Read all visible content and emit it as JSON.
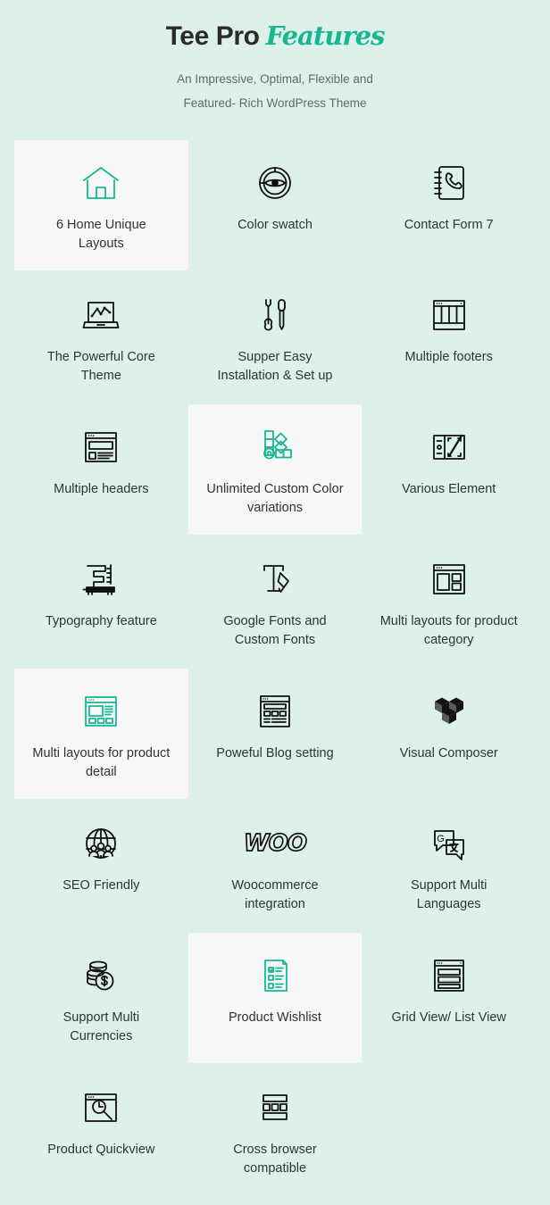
{
  "header": {
    "title_main": "Tee Pro",
    "title_script": "Features",
    "subtitle_line1": "An Impressive, Optimal, Flexible and",
    "subtitle_line2": "Featured- Rich WordPress Theme"
  },
  "theme": {
    "background": "#ddf0ea",
    "card_highlight": "#f7f7f7",
    "accent": "#16b894",
    "icon_dark": "#111111",
    "text": "#2e3533",
    "subtitle_text": "#5c6b68"
  },
  "features": [
    {
      "label": "6 Home Unique Layouts",
      "icon": "home-icon",
      "highlight": true,
      "accent": true
    },
    {
      "label": "Color swatch",
      "icon": "eye-swatch-icon",
      "highlight": false,
      "accent": false
    },
    {
      "label": "Contact Form 7",
      "icon": "phonebook-icon",
      "highlight": false,
      "accent": false
    },
    {
      "label": "The Powerful Core Theme",
      "icon": "laptop-chart-icon",
      "highlight": false,
      "accent": false
    },
    {
      "label": "Supper Easy Installation & Set up",
      "icon": "tools-icon",
      "highlight": false,
      "accent": false
    },
    {
      "label": "Multiple footers",
      "icon": "footers-layout-icon",
      "highlight": false,
      "accent": false
    },
    {
      "label": "Multiple headers",
      "icon": "headers-layout-icon",
      "highlight": false,
      "accent": false
    },
    {
      "label": "Unlimited Custom Color variations",
      "icon": "color-palette-icon",
      "highlight": true,
      "accent": true
    },
    {
      "label": "Various Element",
      "icon": "elements-icon",
      "highlight": false,
      "accent": false
    },
    {
      "label": "Typography feature",
      "icon": "typography-ruler-icon",
      "highlight": false,
      "accent": false
    },
    {
      "label": "Google Fonts and Custom Fonts",
      "icon": "font-pen-icon",
      "highlight": false,
      "accent": false
    },
    {
      "label": "Multi layouts for product category",
      "icon": "category-layout-icon",
      "highlight": false,
      "accent": false
    },
    {
      "label": "Multi layouts for product detail",
      "icon": "product-layout-icon",
      "highlight": true,
      "accent": true
    },
    {
      "label": "Poweful Blog setting",
      "icon": "blog-layout-icon",
      "highlight": false,
      "accent": false
    },
    {
      "label": "Visual Composer",
      "icon": "visual-composer-icon",
      "highlight": false,
      "accent": false
    },
    {
      "label": "SEO Friendly",
      "icon": "globe-people-icon",
      "highlight": false,
      "accent": false
    },
    {
      "label": "Woocommerce integration",
      "icon": "woo-logo-icon",
      "highlight": false,
      "accent": false
    },
    {
      "label": "Support Multi Languages",
      "icon": "translate-icon",
      "highlight": false,
      "accent": false
    },
    {
      "label": "Support Multi Currencies",
      "icon": "coins-dollar-icon",
      "highlight": false,
      "accent": false
    },
    {
      "label": "Product Wishlist",
      "icon": "checklist-icon",
      "highlight": true,
      "accent": true
    },
    {
      "label": "Grid View/ List View",
      "icon": "listview-icon",
      "highlight": false,
      "accent": false
    },
    {
      "label": "Product Quickview",
      "icon": "quickview-icon",
      "highlight": false,
      "accent": false
    },
    {
      "label": "Cross browser compatible",
      "icon": "crossbrowser-icon",
      "highlight": false,
      "accent": false
    },
    {
      "label": "",
      "icon": "",
      "highlight": false,
      "accent": false
    }
  ]
}
